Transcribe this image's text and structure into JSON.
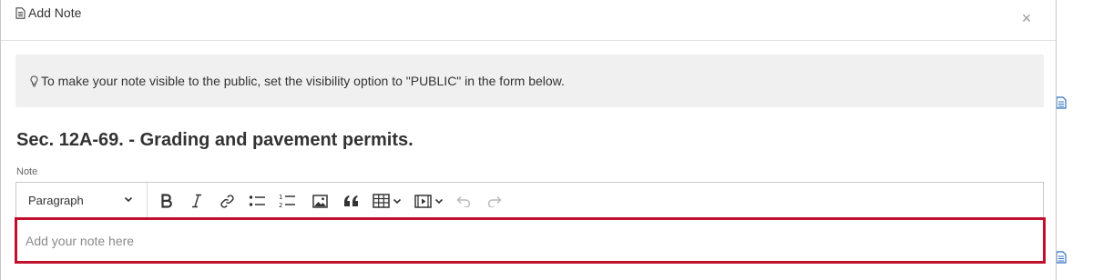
{
  "modal": {
    "title": "Add Note",
    "close_symbol": "×"
  },
  "alert": {
    "text": "To make your note visible to the public, set the visibility option to \"PUBLIC\" in the form below."
  },
  "section": {
    "title": "Sec. 12A-69. - Grading and pavement permits."
  },
  "note_field": {
    "label": "Note",
    "placeholder": "Add your note here"
  },
  "toolbar": {
    "block_format": "Paragraph",
    "buttons": [
      "bold-icon",
      "italic-icon",
      "link-icon",
      "bulleted-list-icon",
      "numbered-list-icon",
      "image-icon",
      "blockquote-icon",
      "table-icon",
      "media-icon",
      "undo-icon",
      "redo-icon"
    ]
  },
  "colors": {
    "focus_border": "#c0102e",
    "alert_background": "#f0f0f0",
    "side_icon": "#2f6fbf"
  }
}
